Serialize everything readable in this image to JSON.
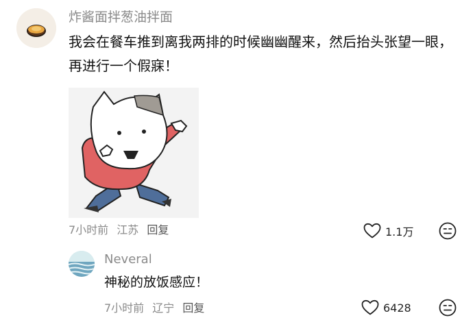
{
  "comment": {
    "username": "炸酱面拌葱油拌面",
    "text": "我会在餐车推到离我两排的时候幽幽醒来，然后抬头张望一眼，再进行一个假寐！",
    "time": "7小时前",
    "location": "江苏",
    "reply_label": "回复",
    "likes": "1.1万",
    "icons": {
      "avatar": "noodle-bowl-avatar",
      "like": "heart-outline-icon",
      "dislike": "meh-face-icon",
      "sticker": "cartoon-cat-sticker"
    }
  },
  "reply": {
    "username": "Neveral",
    "text": "神秘的放饭感应！",
    "time": "7小时前",
    "location": "辽宁",
    "reply_label": "回复",
    "likes": "6428",
    "icons": {
      "avatar": "sea-landscape-avatar",
      "like": "heart-outline-icon",
      "dislike": "meh-face-icon"
    }
  },
  "colors": {
    "meta_text": "#8a8a8a",
    "body_text": "#111111",
    "sticker_shirt": "#e06363",
    "sticker_pants": "#4f6e9a"
  }
}
